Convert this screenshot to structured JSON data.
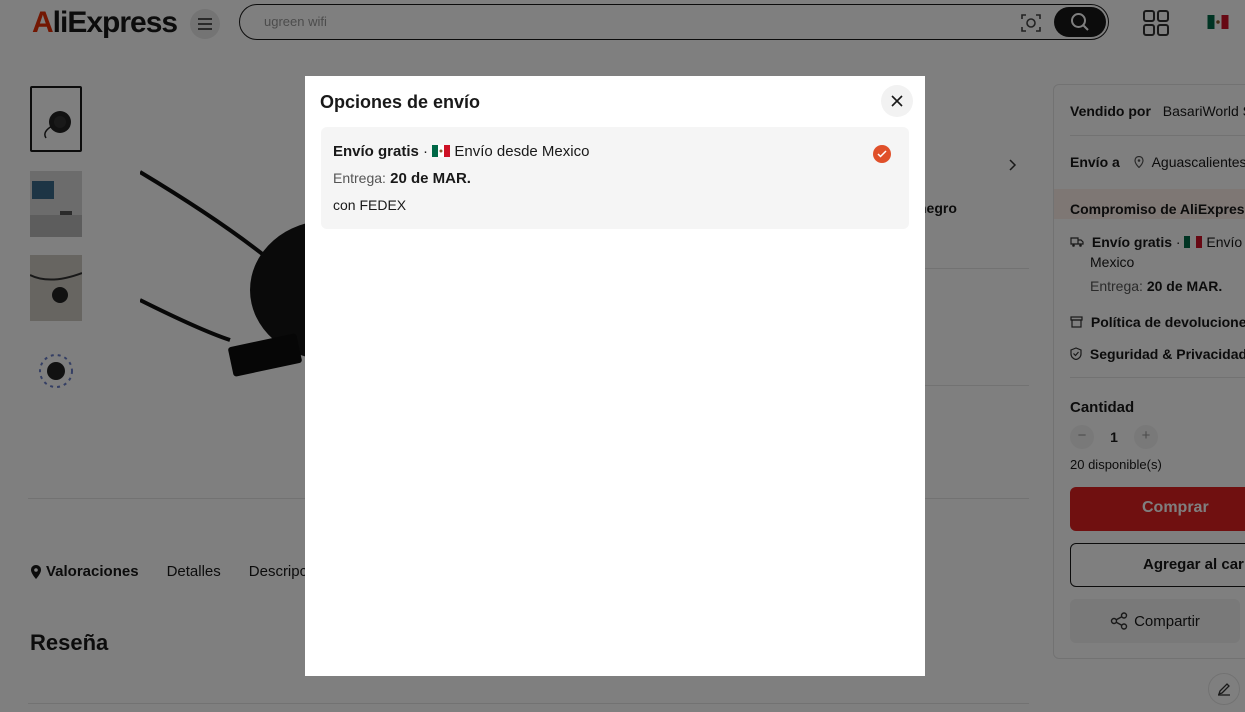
{
  "header": {
    "logo_a": "A",
    "logo_rest": "liExpress",
    "search_placeholder": "ugreen wifi"
  },
  "tabs": [
    "Valoraciones",
    "Detalles",
    "Descripc"
  ],
  "review_title": "Reseña",
  "middle": {
    "color_partial": "negro"
  },
  "right": {
    "sold_by_label": "Vendido por",
    "sold_by_value": "BasariWorld S",
    "ship_to_label": "Envío a",
    "ship_to_value": "Aguascalientes",
    "commitment": "Compromiso de AliExpress",
    "free_shipping": "Envío gratis",
    "ship_from_partial": "Envío",
    "ship_from_country": "Mexico",
    "delivery_label": "Entrega:",
    "delivery_date": "20 de MAR.",
    "returns": "Política de devoluciones",
    "security": "Seguridad & Privacidad",
    "quantity_label": "Cantidad",
    "quantity_value": "1",
    "available": "20 disponible(s)",
    "buy": "Comprar",
    "add_to_cart": "Agregar al car",
    "share": "Compartir"
  },
  "modal": {
    "title": "Opciones de envío",
    "option": {
      "free": "Envío gratis",
      "separator": "·",
      "ship_from": "Envío desde Mexico",
      "delivery_label": "Entrega:",
      "delivery_date": "20 de MAR.",
      "carrier": "con FEDEX"
    }
  },
  "colors": {
    "accent": "#e02020",
    "check": "#e0502a",
    "overlay": "rgba(0,0,0,0.5)"
  }
}
